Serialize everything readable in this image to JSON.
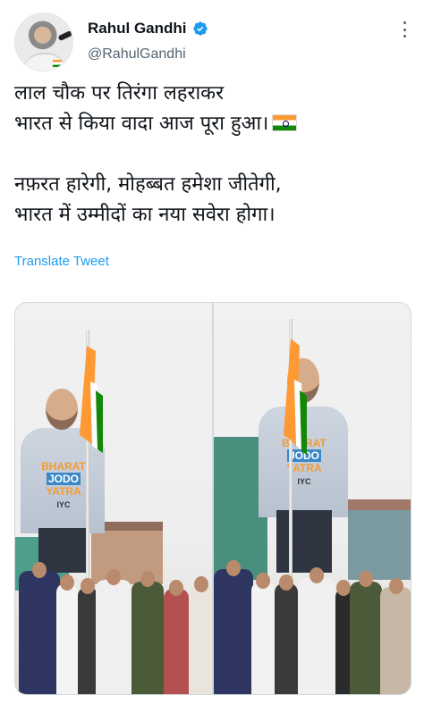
{
  "author": {
    "display_name": "Rahul Gandhi",
    "handle": "@RahulGandhi",
    "verified": true,
    "avatar_icon": "profile-photo"
  },
  "tweet": {
    "lines": [
      "लाल चौक पर तिरंगा लहराकर",
      "भारत से किया वादा आज पूरा हुआ।",
      "नफ़रत हारेगी, मोहब्बत हमेशा जीतेगी,",
      "भारत में उम्मीदों का नया सवेरा होगा।"
    ],
    "flag_emoji": "indian-flag-emoji"
  },
  "translate_label": "Translate Tweet",
  "media": {
    "photo_count": 2,
    "banner_text": [
      "BHARAT",
      "JODO",
      "YATRA",
      "IYC"
    ]
  },
  "colors": {
    "accent": "#1d9bf0",
    "text": "#0f1419",
    "secondary": "#536471",
    "saffron": "#ff9933",
    "green": "#138808"
  }
}
